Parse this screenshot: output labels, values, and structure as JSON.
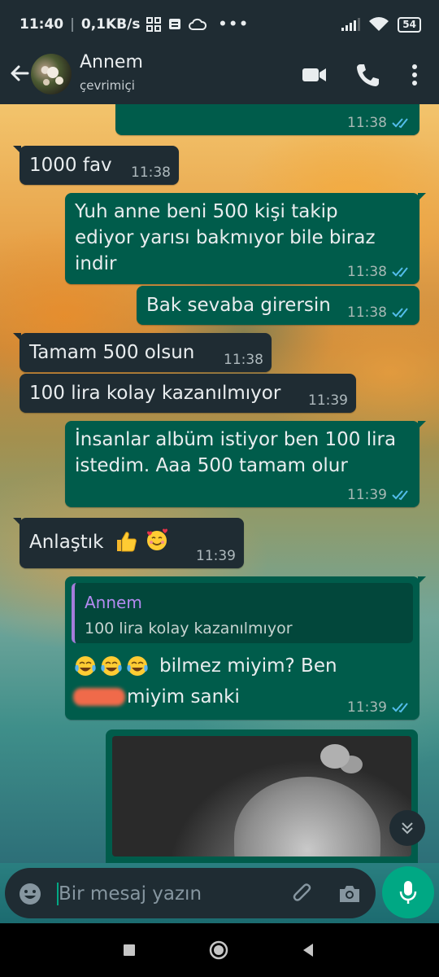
{
  "status_bar": {
    "time": "11:40",
    "network_speed": "0,1KB/s",
    "battery": "54",
    "more": "•••"
  },
  "header": {
    "contact_name": "Annem",
    "contact_status": "çevrimiçi"
  },
  "messages": [
    {
      "direction": "out",
      "text": "",
      "time": "11:38",
      "status": "read"
    },
    {
      "direction": "in",
      "text": "1000 fav",
      "time": "11:38"
    },
    {
      "direction": "out",
      "text": "Yuh anne beni 500 kişi takip ediyor yarısı bakmıyor bile biraz indir",
      "time": "11:38",
      "status": "read"
    },
    {
      "direction": "out",
      "text": "Bak sevaba girersin",
      "time": "11:38",
      "status": "read"
    },
    {
      "direction": "in",
      "text": "Tamam 500 olsun",
      "time": "11:38"
    },
    {
      "direction": "in",
      "text": "100 lira kolay kazanılmıyor",
      "time": "11:39"
    },
    {
      "direction": "out",
      "text": "İnsanlar albüm istiyor ben 100 lira istedim. Aaa 500 tamam olur",
      "time": "11:39",
      "status": "read"
    },
    {
      "direction": "in",
      "text": "Anlaştık",
      "emojis": [
        "thumbs-up",
        "smiling-face-with-hearts"
      ],
      "time": "11:39"
    },
    {
      "direction": "out",
      "quote_author": "Annem",
      "quote_text": "100 lira kolay kazanılmıyor",
      "text_part1": "bilmez miyim? Ben",
      "text_part2": "miyim sanki",
      "emojis": [
        "tears-of-joy",
        "tears-of-joy",
        "tears-of-joy"
      ],
      "time": "11:39",
      "status": "read"
    },
    {
      "direction": "out",
      "type": "image"
    }
  ],
  "input": {
    "placeholder": "Bir mesaj yazın"
  },
  "colors": {
    "header_bg": "#1f2c33",
    "incoming_bubble": "#1f2c33",
    "outgoing_bubble": "#005c4b",
    "accent": "#00a884",
    "read_ticks": "#53bdeb",
    "quote_author": "#b38af0"
  },
  "icons": [
    "back-arrow-icon",
    "video-call-icon",
    "phone-icon",
    "more-vert-icon",
    "emoji-icon",
    "attach-icon",
    "camera-icon",
    "mic-icon",
    "chevron-down-icon"
  ]
}
